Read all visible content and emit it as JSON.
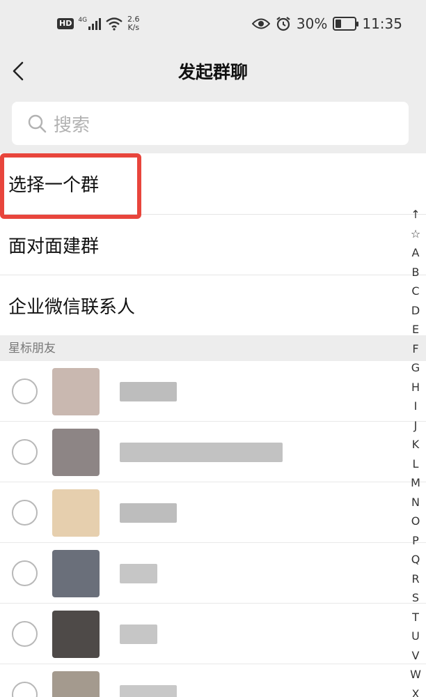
{
  "status_bar": {
    "hd": "HD",
    "network": "4G",
    "speed_value": "2.6",
    "speed_unit": "K/s",
    "battery_text": "30%",
    "battery_level": 0.3,
    "time": "11:35"
  },
  "nav": {
    "title": "发起群聊"
  },
  "search": {
    "placeholder": "搜索"
  },
  "menu": {
    "items": [
      {
        "label": "选择一个群"
      },
      {
        "label": "面对面建群"
      },
      {
        "label": "企业微信联系人"
      }
    ]
  },
  "section": {
    "starred_title": "星标朋友"
  },
  "contacts": [
    {
      "avatar_color": "#c9b8b0"
    },
    {
      "avatar_color": "#8d8585"
    },
    {
      "avatar_color": "#e6cfae"
    },
    {
      "avatar_color": "#6a6f7a"
    },
    {
      "avatar_color": "#4e4a48"
    },
    {
      "avatar_color": "#a49a8e"
    }
  ],
  "index_bar": [
    "↑",
    "☆",
    "A",
    "B",
    "C",
    "D",
    "E",
    "F",
    "G",
    "H",
    "I",
    "J",
    "K",
    "L",
    "M",
    "N",
    "O",
    "P",
    "Q",
    "R",
    "S",
    "T",
    "U",
    "V",
    "W",
    "X"
  ],
  "colors": {
    "highlight": "#e8453c",
    "background": "#ededed"
  }
}
